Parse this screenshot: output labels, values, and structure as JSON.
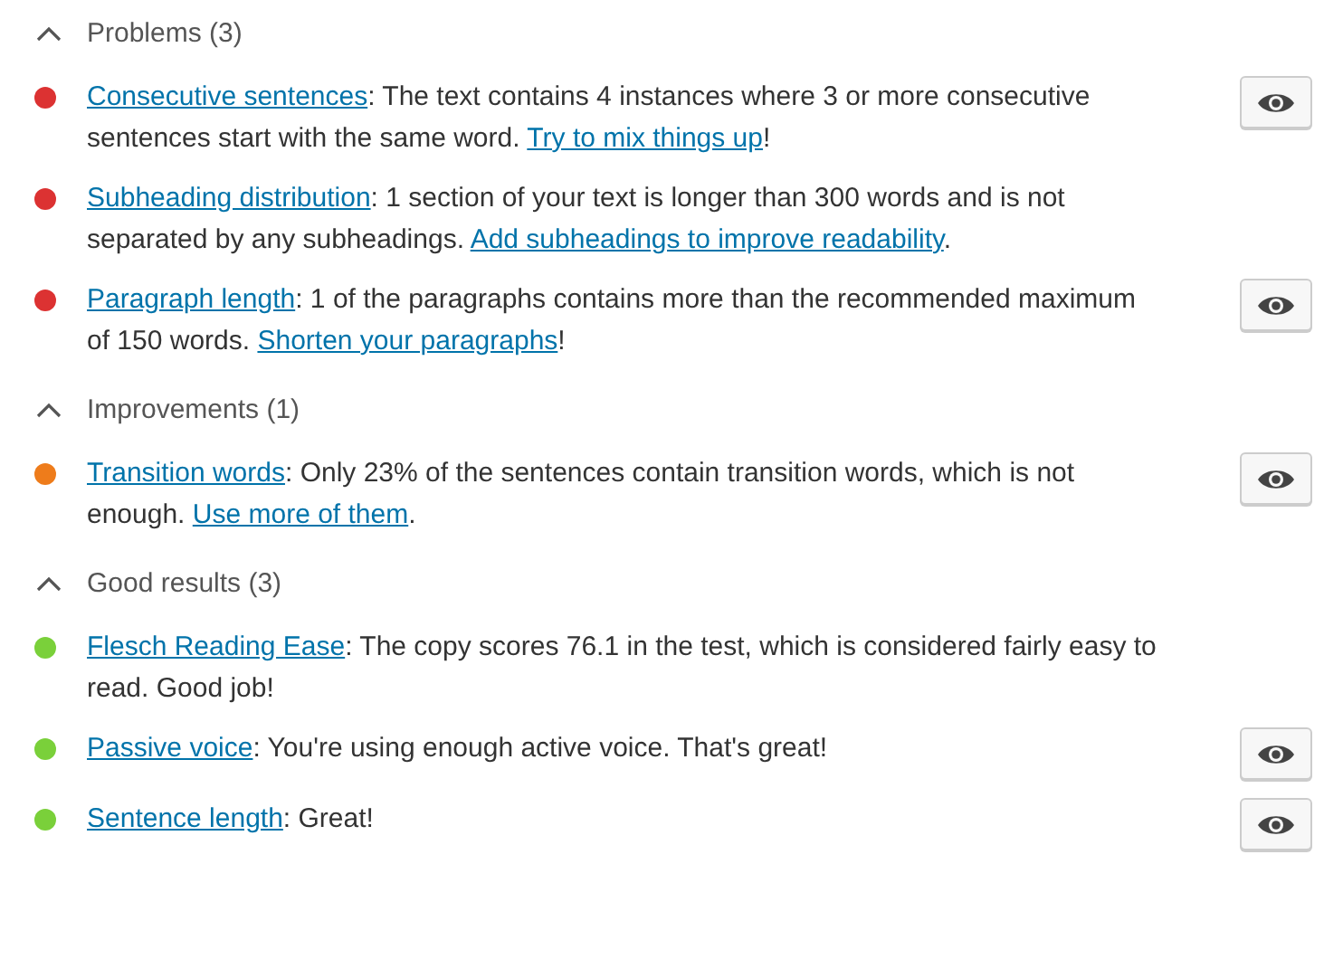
{
  "sections": [
    {
      "title": "Problems (3)",
      "expanded": true,
      "items": [
        {
          "color": "#dc3232",
          "has_eye": true,
          "parts": [
            {
              "kind": "link",
              "text": "Consecutive sentences"
            },
            {
              "kind": "text",
              "text": ": The text contains 4 instances where 3 or more consecutive sentences start with the same word. "
            },
            {
              "kind": "link",
              "text": "Try to mix things up"
            },
            {
              "kind": "text",
              "text": "!"
            }
          ]
        },
        {
          "color": "#dc3232",
          "has_eye": false,
          "parts": [
            {
              "kind": "link",
              "text": "Subheading distribution"
            },
            {
              "kind": "text",
              "text": ": 1 section of your text is longer than 300 words and is not separated by any subheadings. "
            },
            {
              "kind": "link",
              "text": "Add subheadings to improve readability"
            },
            {
              "kind": "text",
              "text": "."
            }
          ]
        },
        {
          "color": "#dc3232",
          "has_eye": true,
          "parts": [
            {
              "kind": "link",
              "text": "Paragraph length"
            },
            {
              "kind": "text",
              "text": ": 1 of the paragraphs contains more than the recommended maximum of 150 words. "
            },
            {
              "kind": "link",
              "text": "Shorten your paragraphs"
            },
            {
              "kind": "text",
              "text": "!"
            }
          ]
        }
      ]
    },
    {
      "title": "Improvements (1)",
      "expanded": true,
      "items": [
        {
          "color": "#ee7c1b",
          "has_eye": true,
          "parts": [
            {
              "kind": "link",
              "text": "Transition words"
            },
            {
              "kind": "text",
              "text": ": Only 23% of the sentences contain transition words, which is not enough. "
            },
            {
              "kind": "link",
              "text": "Use more of them"
            },
            {
              "kind": "text",
              "text": "."
            }
          ]
        }
      ]
    },
    {
      "title": "Good results (3)",
      "expanded": true,
      "items": [
        {
          "color": "#7ad03a",
          "has_eye": false,
          "parts": [
            {
              "kind": "link",
              "text": "Flesch Reading Ease"
            },
            {
              "kind": "text",
              "text": ": The copy scores 76.1 in the test, which is considered fairly easy to read. Good job!"
            }
          ]
        },
        {
          "color": "#7ad03a",
          "has_eye": true,
          "parts": [
            {
              "kind": "link",
              "text": "Passive voice"
            },
            {
              "kind": "text",
              "text": ": You're using enough active voice. That's great!"
            }
          ]
        },
        {
          "color": "#7ad03a",
          "has_eye": true,
          "parts": [
            {
              "kind": "link",
              "text": "Sentence length"
            },
            {
              "kind": "text",
              "text": ": Great!"
            }
          ]
        }
      ]
    }
  ]
}
